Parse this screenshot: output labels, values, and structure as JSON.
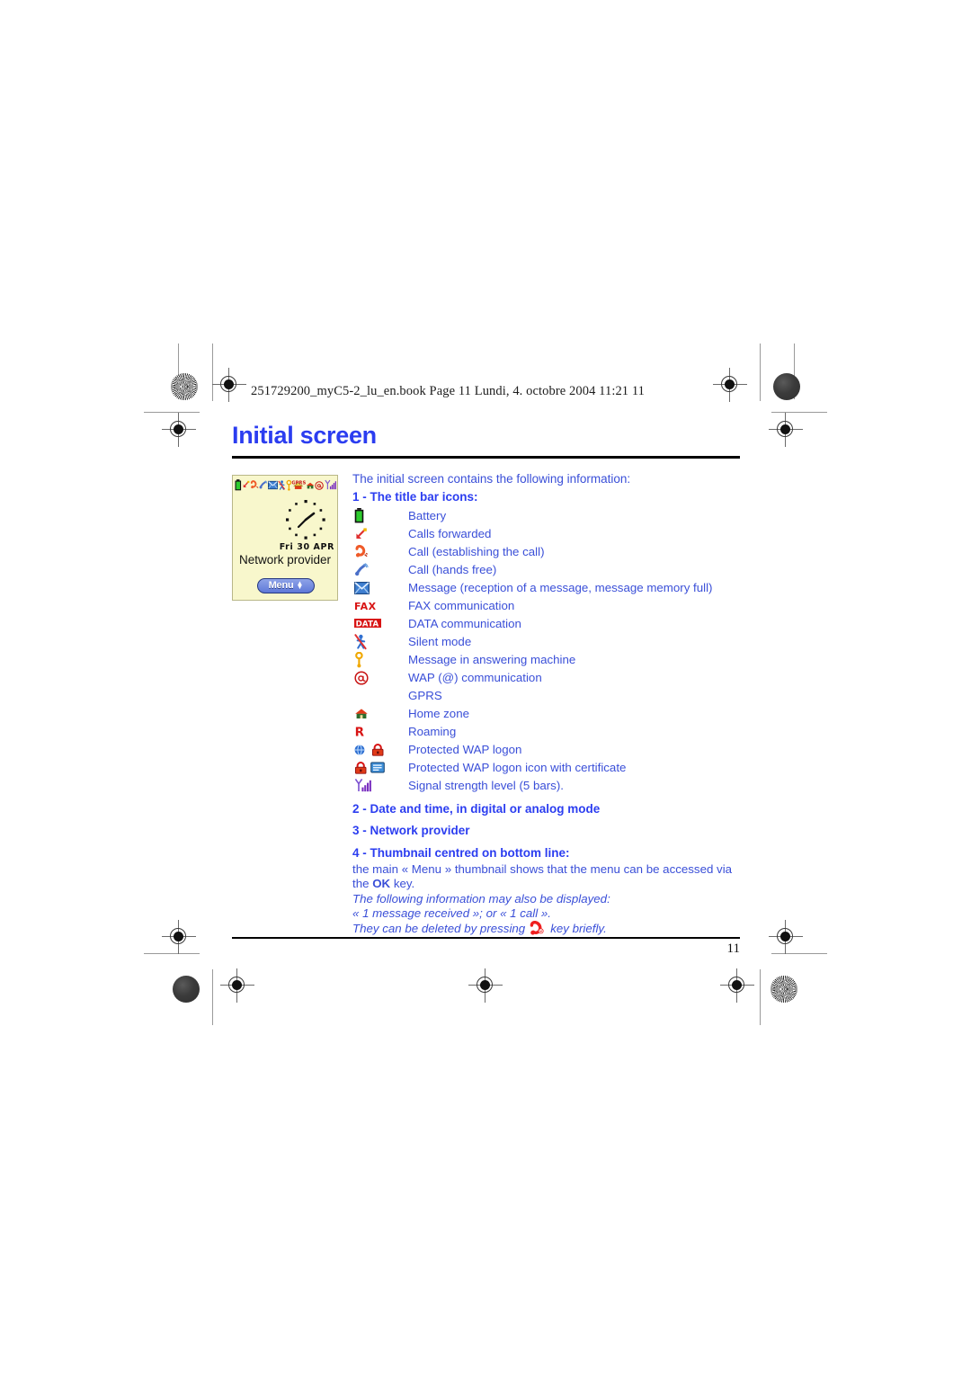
{
  "document": {
    "book_header": "251729200_myC5-2_lu_en.book  Page 11  Lundi, 4. octobre 2004  11:21 11",
    "page_title": "Initial screen",
    "page_number": "11",
    "accent_color": "#2b3df0",
    "body_color": "#3a4fd8"
  },
  "phone_preview": {
    "screen_bg": "#f8f7cc",
    "date": "Fri 30 APR",
    "provider": "Network provider",
    "menu_label": "Menu",
    "status_icons": [
      "battery-icon",
      "calls-forwarded-icon",
      "call-establishing-icon",
      "call-handsfree-icon",
      "message-icon",
      "silent-mode-icon",
      "answering-machine-icon",
      "gprs-icon",
      "home-zone-icon",
      "wap-icon",
      "signal-strength-icon"
    ]
  },
  "main": {
    "intro": "The initial screen contains the following information:",
    "section1_heading": "1 - The title bar icons:",
    "icon_list": [
      {
        "icon": "battery-icon",
        "label": "Battery"
      },
      {
        "icon": "calls-forwarded-icon",
        "label": "Calls forwarded"
      },
      {
        "icon": "call-establishing-icon",
        "label": "Call (establishing the call)"
      },
      {
        "icon": "call-handsfree-icon",
        "label": "Call (hands free)"
      },
      {
        "icon": "message-icon",
        "label": "Message (reception of a message, message memory full)"
      },
      {
        "icon": "fax-icon",
        "label": "FAX communication"
      },
      {
        "icon": "data-icon",
        "label": "DATA communication"
      },
      {
        "icon": "silent-mode-icon",
        "label": "Silent mode"
      },
      {
        "icon": "answering-machine-icon",
        "label": "Message in answering machine"
      },
      {
        "icon": "wap-at-icon",
        "label": "WAP (@) communication"
      },
      {
        "icon": "gprs-icon",
        "label": "GPRS"
      },
      {
        "icon": "home-zone-icon",
        "label": "Home zone"
      },
      {
        "icon": "roaming-icon",
        "label": "Roaming"
      },
      {
        "icon": "protected-wap-logon-icon",
        "label": "Protected WAP logon"
      },
      {
        "icon": "protected-wap-cert-icon",
        "label": "Protected WAP logon icon with certificate"
      },
      {
        "icon": "signal-strength-icon",
        "label": "Signal strength level (5 bars)."
      }
    ],
    "section2_heading": "2 - Date and time, in digital or analog mode",
    "section3_heading": "3 - Network provider",
    "section4_heading": "4 - Thumbnail centred on bottom line:",
    "section4_text_a": "the main « Menu » thumbnail shows that the menu can be accessed via the ",
    "section4_key": "OK",
    "section4_text_b": " key.",
    "note_1": "The following information may also be displayed:",
    "note_2": "« 1 message received »; or « 1 call ».",
    "note_3a": "They can be deleted by pressing",
    "note_3b": "key briefly."
  }
}
